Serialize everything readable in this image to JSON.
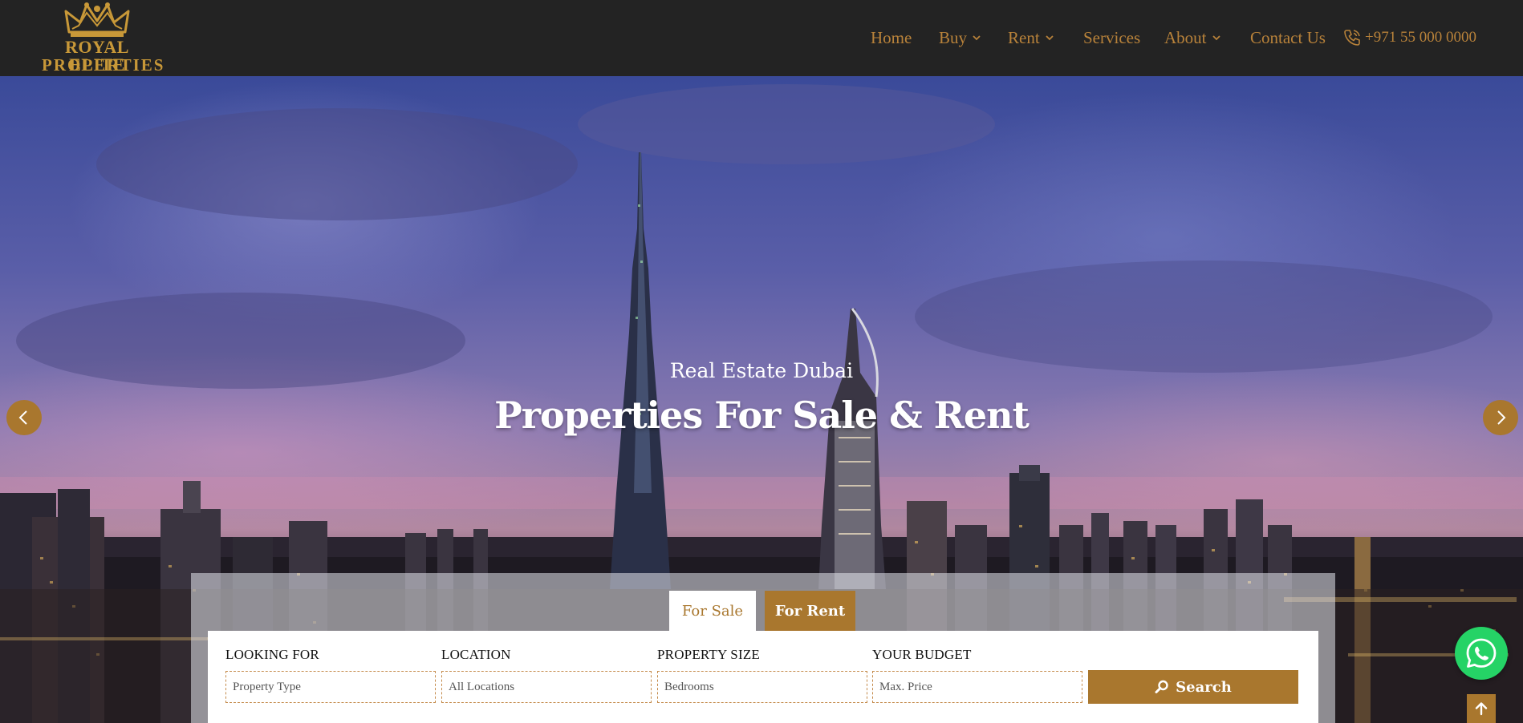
{
  "brand": {
    "line1": "ROYAL ELITE",
    "line2": "PROPERTIES",
    "color": "#c89838"
  },
  "nav": {
    "home": "Home",
    "buy": "Buy",
    "rent": "Rent",
    "services": "Services",
    "about": "About",
    "contact": "Contact Us",
    "phone": "+971 55 000 0000"
  },
  "hero": {
    "subtitle": "Real Estate Dubai",
    "title": "Properties For Sale & Rent"
  },
  "search": {
    "tabs": {
      "sale": "For Sale",
      "rent": "For Rent"
    },
    "looking_for": {
      "label": "LOOKING FOR",
      "value": "Property Type"
    },
    "location": {
      "label": "LOCATION",
      "value": "All Locations"
    },
    "size": {
      "label": "PROPERTY SIZE",
      "value": "Bedrooms"
    },
    "budget": {
      "label": "YOUR BUDGET",
      "value": "Max. Price"
    },
    "button": "Search"
  },
  "colors": {
    "accent": "#a9772e",
    "header": "#232323",
    "whatsapp": "#25d366"
  },
  "icons": [
    "crown-icon",
    "chevron-down-icon",
    "phone-icon",
    "chevron-left-icon",
    "chevron-right-icon",
    "search-icon",
    "whatsapp-icon",
    "arrow-up-icon"
  ]
}
